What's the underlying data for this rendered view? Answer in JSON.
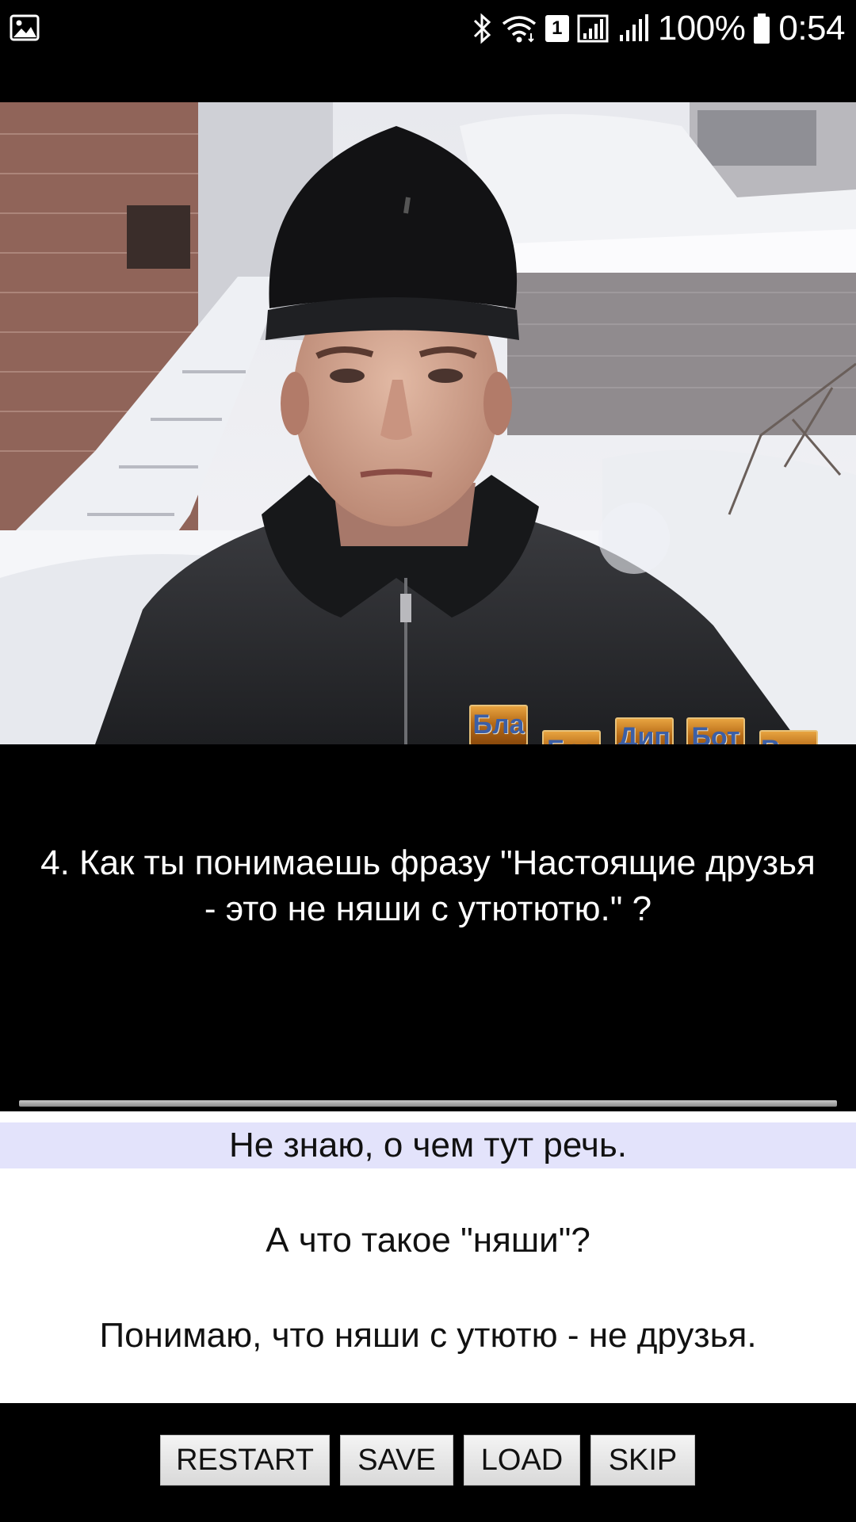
{
  "status_bar": {
    "battery": "100%",
    "time": "0:54",
    "sim_slot": "1",
    "icons": [
      "gallery-icon",
      "bluetooth-icon",
      "wifi-icon",
      "sim-1-icon",
      "signal-icon",
      "signal-icon",
      "battery-icon"
    ]
  },
  "scene": {
    "stickers": [
      "Бла",
      "Бес",
      "Дип",
      "Бот",
      "Ви..."
    ]
  },
  "question": {
    "text": "4. Как ты понимаешь фразу \"Настоящие друзья\n- это не няши с утютютю.\" ?"
  },
  "answers": [
    {
      "label": "Не знаю, о чем тут речь.",
      "selected": true
    },
    {
      "label": "А что такое \"няши\"?",
      "selected": false
    },
    {
      "label": "Понимаю, что няши с утютю - не друзья.",
      "selected": false
    }
  ],
  "buttons": {
    "restart": "RESTART",
    "save": "SAVE",
    "load": "LOAD",
    "skip": "SKIP"
  },
  "colors": {
    "background": "#000000",
    "answers_bg": "#ffffff",
    "selected_answer_bg": "#e3e3fb"
  }
}
